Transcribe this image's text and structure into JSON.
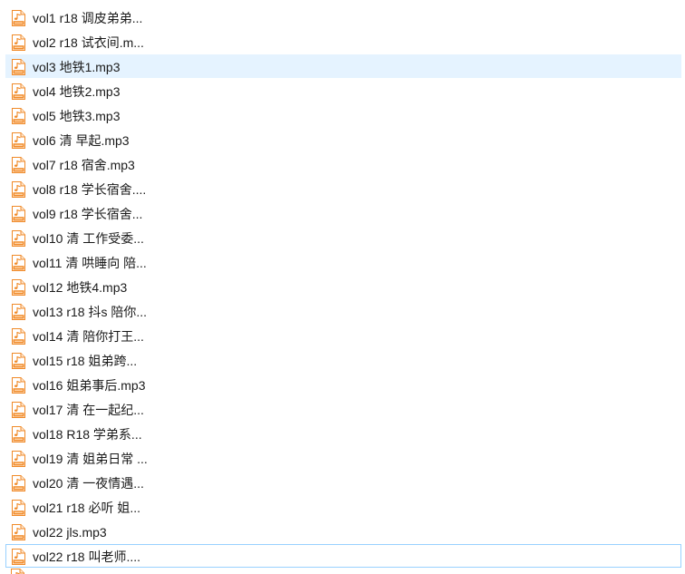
{
  "file_list": {
    "icon": "mp3-audio-file-icon",
    "accent_color": "#f08a28",
    "hover_color": "#e5f3ff",
    "focus_border_color": "#99d1ff",
    "items": [
      {
        "label": "vol1 r18 调皮弟弟..."
      },
      {
        "label": "vol2 r18 试衣间.m..."
      },
      {
        "label": "vol3 地铁1.mp3",
        "state": "hovered"
      },
      {
        "label": "vol4 地铁2.mp3"
      },
      {
        "label": "vol5 地铁3.mp3"
      },
      {
        "label": "vol6 清 早起.mp3"
      },
      {
        "label": "vol7 r18 宿舍.mp3"
      },
      {
        "label": "vol8 r18 学长宿舍...."
      },
      {
        "label": "vol9 r18 学长宿舍..."
      },
      {
        "label": "vol10 清 工作受委..."
      },
      {
        "label": "vol11 清 哄睡向 陪..."
      },
      {
        "label": "vol12 地铁4.mp3"
      },
      {
        "label": "vol13 r18 抖s 陪你..."
      },
      {
        "label": "vol14 清 陪你打王..."
      },
      {
        "label": "vol15 r18 姐弟跨..."
      },
      {
        "label": "vol16 姐弟事后.mp3"
      },
      {
        "label": "vol17 清 在一起纪..."
      },
      {
        "label": "vol18 R18 学弟系..."
      },
      {
        "label": "vol19 清 姐弟日常 ..."
      },
      {
        "label": "vol20 清 一夜情遇..."
      },
      {
        "label": "vol21 r18 必听 姐..."
      },
      {
        "label": "vol22 jls.mp3"
      },
      {
        "label": "vol22 r18 叫老师....",
        "state": "focused"
      }
    ]
  }
}
